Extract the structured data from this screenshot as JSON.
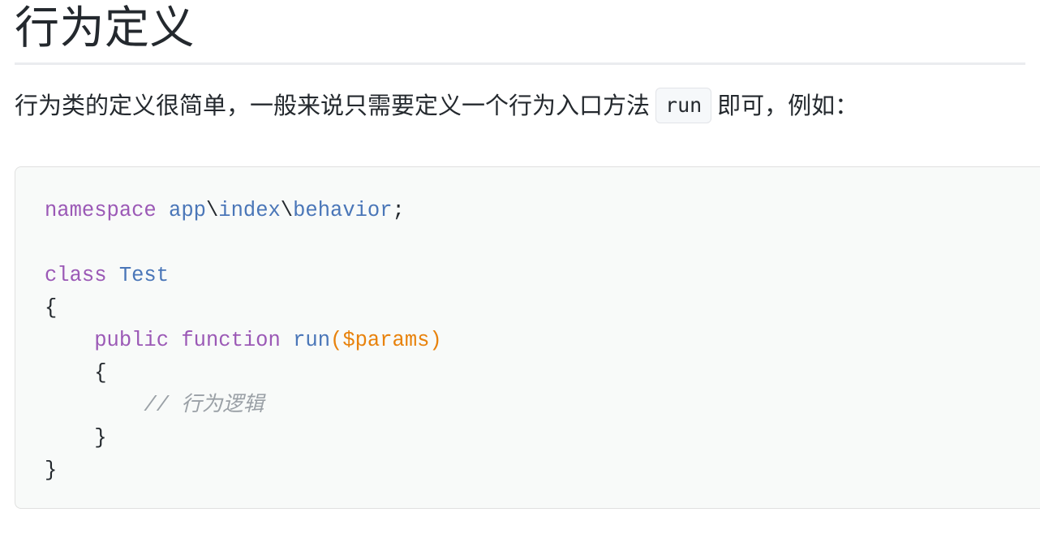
{
  "heading": {
    "title": "行为定义"
  },
  "paragraph": {
    "before_code": "行为类的定义很简单，一般来说只需要定义一个行为入口方法",
    "inline_code": "run",
    "after_code": "即可，例如："
  },
  "code_block": {
    "language": "php",
    "lines": [
      {
        "tokens": [
          {
            "text": "namespace",
            "type": "keyword"
          },
          {
            "text": " ",
            "type": "punct"
          },
          {
            "text": "app",
            "type": "entity"
          },
          {
            "text": "\\",
            "type": "punct"
          },
          {
            "text": "index",
            "type": "entity"
          },
          {
            "text": "\\",
            "type": "punct"
          },
          {
            "text": "behavior",
            "type": "entity"
          },
          {
            "text": ";",
            "type": "punct"
          }
        ]
      },
      {
        "tokens": []
      },
      {
        "tokens": [
          {
            "text": "class",
            "type": "keyword"
          },
          {
            "text": " ",
            "type": "punct"
          },
          {
            "text": "Test",
            "type": "entity"
          }
        ]
      },
      {
        "tokens": [
          {
            "text": "{",
            "type": "punct"
          }
        ]
      },
      {
        "tokens": [
          {
            "text": "    ",
            "type": "punct"
          },
          {
            "text": "public",
            "type": "keyword"
          },
          {
            "text": " ",
            "type": "punct"
          },
          {
            "text": "function",
            "type": "keyword"
          },
          {
            "text": " ",
            "type": "punct"
          },
          {
            "text": "run",
            "type": "entity"
          },
          {
            "text": "($params)",
            "type": "variable"
          }
        ]
      },
      {
        "tokens": [
          {
            "text": "    {",
            "type": "punct"
          }
        ]
      },
      {
        "tokens": [
          {
            "text": "        ",
            "type": "punct"
          },
          {
            "text": "// 行为逻辑",
            "type": "comment"
          }
        ]
      },
      {
        "tokens": [
          {
            "text": "    }",
            "type": "punct"
          }
        ]
      },
      {
        "tokens": [
          {
            "text": "}",
            "type": "punct"
          }
        ]
      }
    ]
  },
  "colors": {
    "page_background": "#ffffff",
    "text": "#24292e",
    "rule": "#eaecef",
    "code_background": "#f8faf9",
    "code_border": "#e0e0e0",
    "inline_code_background": "#f6f8fa",
    "keyword": "#9b59b6",
    "entity": "#4a76b8",
    "variable": "#e8820c",
    "comment": "#9aa0a6"
  }
}
